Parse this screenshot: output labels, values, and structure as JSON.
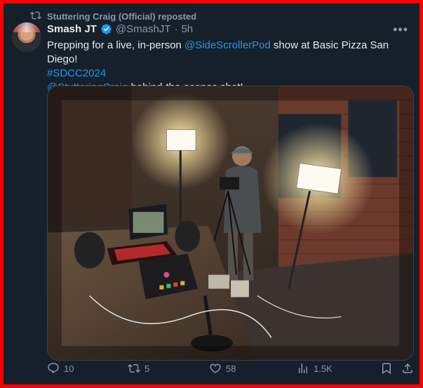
{
  "repost": {
    "text": "Stuttering Craig (Official) reposted"
  },
  "tweet": {
    "name": "Smash JT",
    "handle": "@SmashJT",
    "separator": "·",
    "time": "5h",
    "text_part1": "Prepping for a live, in-person ",
    "mention1": "@SideScrollerPod",
    "text_part2": " show at Basic Pizza San Diego!",
    "hashtag": "#SDCC2024",
    "mention2": "@StutteringCraig",
    "text_part3": " behind-the-scenes shot!"
  },
  "actions": {
    "replies": "10",
    "reposts": "5",
    "likes": "58",
    "views": "1.5K"
  },
  "colors": {
    "background": "#15202b",
    "accent": "#1d9bf0",
    "muted": "#8b98a5",
    "border": "#ff0000"
  }
}
